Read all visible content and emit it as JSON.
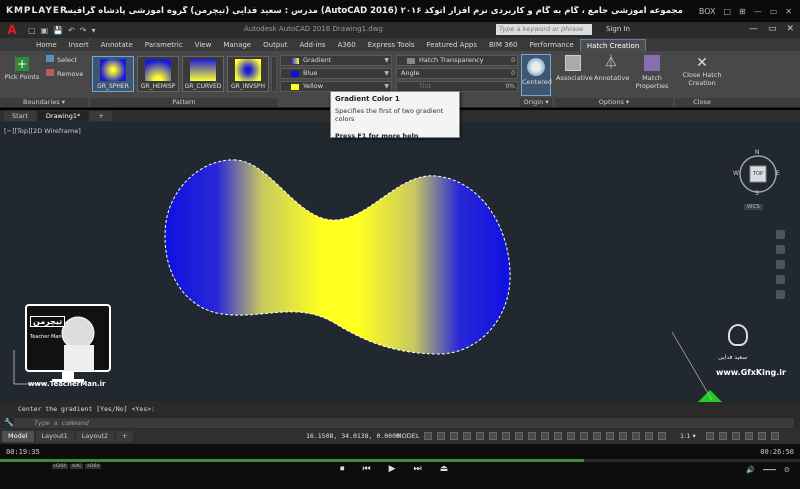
{
  "player": {
    "logo": "KMPLAYER",
    "caption": "مجموعه آموزشی جامع ، گام به گام و کاربردی نرم افزار اتوکد ۲۰۱۶ (AutoCAD 2016) مدرس : سعید فدایی (تیچرمن) گروه آموزشی پادشاه گرافیست ها",
    "controls": [
      "BOX",
      "□",
      "⊞",
      "—",
      "▭",
      "✕"
    ],
    "time_current": "00:19:35",
    "time_total": "00:26:50",
    "progress": 0.73,
    "badges": [
      "H264",
      "AAC",
      "H264"
    ],
    "buttons": [
      "⏹",
      "⏮",
      "▶",
      "⏭",
      "⏏"
    ],
    "right_icons": [
      "🔊",
      "━━━",
      "⚙"
    ]
  },
  "app": {
    "logo": "A",
    "qat": [
      "▢",
      "▣",
      "💾",
      "↶",
      "↷",
      "▾"
    ],
    "file_title": "Autodesk AutoCAD 2016   Drawing1.dwg",
    "search_placeholder": "Type a keyword or phrase",
    "signin": "Sign In",
    "window_controls": [
      "—",
      "▭",
      "✕"
    ]
  },
  "ribbon_tabs": [
    {
      "label": "Home",
      "active": false
    },
    {
      "label": "Insert",
      "active": false
    },
    {
      "label": "Annotate",
      "active": false
    },
    {
      "label": "Parametric",
      "active": false
    },
    {
      "label": "View",
      "active": false
    },
    {
      "label": "Manage",
      "active": false
    },
    {
      "label": "Output",
      "active": false
    },
    {
      "label": "Add-ins",
      "active": false
    },
    {
      "label": "A360",
      "active": false
    },
    {
      "label": "Express Tools",
      "active": false
    },
    {
      "label": "Featured Apps",
      "active": false
    },
    {
      "label": "BIM 360",
      "active": false
    },
    {
      "label": "Performance",
      "active": false
    },
    {
      "label": "Hatch Creation",
      "active": true
    }
  ],
  "ribbon": {
    "boundaries_title": "Boundaries ▾",
    "pattern_title": "Pattern",
    "origin_title": "Origin ▾",
    "options_title": "Options ▾",
    "close_title": "Close",
    "pick_points": "Pick Points",
    "select": "Select",
    "remove": "Remove",
    "patterns": [
      "GR_SPHER",
      "GR_HEMISP",
      "GR_CURVED",
      "GR_INVSPH"
    ],
    "gradient_dd": "Gradient",
    "color1_dd": "Blue",
    "color2_dd": "Yellow",
    "transparency_dd": "Hatch Transparency",
    "transparency_val": "0",
    "angle_dd": "Angle",
    "angle_val": "0",
    "tint_dd": "Tint",
    "tint_val": "0%",
    "centered": "Centered",
    "associative": "Associative",
    "annotative": "Annotative",
    "match_properties": "Match Properties",
    "close_hatch": "Close Hatch Creation"
  },
  "tooltip": {
    "title": "Gradient Color 1",
    "desc": "Specifies the first of two gradient colors",
    "help": "Press F1 for more help"
  },
  "file_tabs": [
    {
      "label": "Start",
      "active": false
    },
    {
      "label": "Drawing1*",
      "active": true
    },
    {
      "label": "+",
      "active": false
    }
  ],
  "viewport": {
    "label": "[−][Top][2D Wireframe]",
    "cube_top": "TOP",
    "cube_n": "N",
    "cube_s": "S",
    "cube_e": "E",
    "cube_w": "W",
    "wcs": "WCS"
  },
  "watermarks": {
    "left_url": "www.TeacherMan.ir",
    "left_badge": "تیچرمن",
    "left_sub": "Teacher Man",
    "right_name": "سعید فدایی",
    "right_url": "www.GfxKing.ir"
  },
  "command": {
    "history": "Center the gradient [Yes/No] <Yes>:",
    "placeholder": "Type a command",
    "icon": "🔧"
  },
  "status": {
    "layout_tabs": [
      {
        "label": "Model",
        "active": true
      },
      {
        "label": "Layout1",
        "active": false
      },
      {
        "label": "Layout2",
        "active": false
      },
      {
        "label": "+",
        "active": false
      }
    ],
    "coords": "16.1508, 34.0138, 0.0000",
    "model": "MODEL",
    "scale": "1:1 ▾"
  },
  "colors": {
    "gradient_color1": "#1010e0",
    "gradient_color2": "#ffff20",
    "drawing_bg": "#212830",
    "accent": "#6fa8dc"
  }
}
